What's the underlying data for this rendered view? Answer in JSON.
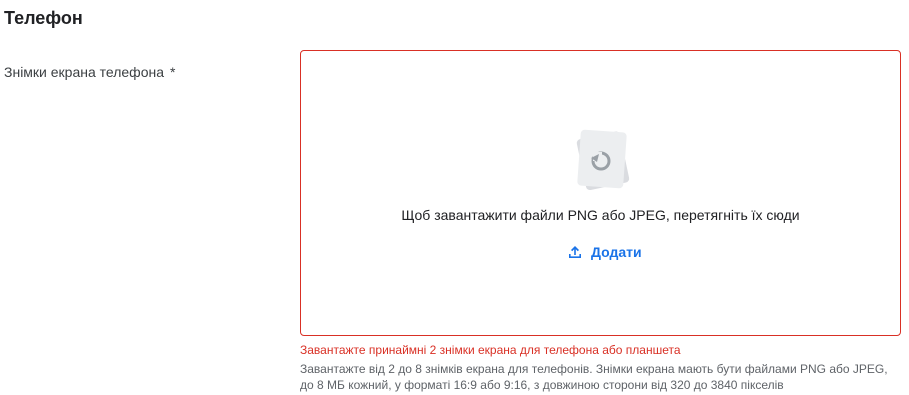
{
  "section": {
    "title": "Телефон"
  },
  "field": {
    "label": "Знімки екрана телефона",
    "required_marker": "*"
  },
  "dropzone": {
    "prompt": "Щоб завантажити файли PNG або JPEG, перетягніть їх сюди",
    "add_label": "Додати",
    "illustration_icon": "image-stack-icon",
    "upload_icon": "upload-icon"
  },
  "messages": {
    "error": "Завантажте принаймні 2 знімки екрана для телефона або планшета",
    "help": "Завантажте від 2 до 8 знімків екрана для телефонів. Знімки екрана мають бути файлами PNG або JPEG, до 8 МБ кожний, у форматі 16:9 або 9:16, з довжиною сторони від 320 до 3840 пікселів"
  },
  "colors": {
    "error": "#d93025",
    "accent": "#1a73e8",
    "text": "#202124",
    "secondary_text": "#5f6368"
  }
}
